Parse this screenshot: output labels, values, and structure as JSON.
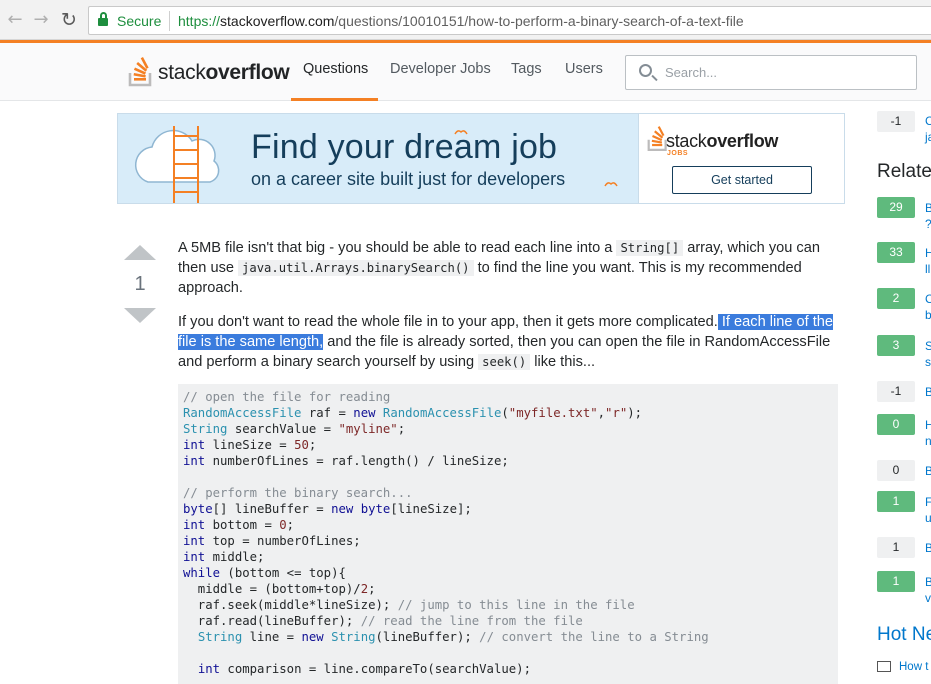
{
  "browser": {
    "secure_label": "Secure",
    "url_scheme": "https://",
    "url_host": "stackoverflow.com",
    "url_path": "/questions/10010151/how-to-perform-a-binary-search-of-a-text-file"
  },
  "header": {
    "logo_light": "stack",
    "logo_bold": "overflow",
    "nav": [
      "Questions",
      "Developer Jobs",
      "Tags",
      "Users"
    ],
    "active_nav": "Questions",
    "search_placeholder": "Search..."
  },
  "ad": {
    "title": "Find your dream job",
    "subtitle": "on a career site built just for developers",
    "logo_light": "stack",
    "logo_bold": "overflow",
    "logo_sub": "JOBS",
    "button": "Get started"
  },
  "answer": {
    "votes": "1",
    "p1": {
      "t1": "A 5MB file isn't that big - you should be able to read each line into a ",
      "c1": "String[]",
      "t2": " array, which you can then use ",
      "c2": "java.util.Arrays.binarySearch()",
      "t3": " to find the line you want. This is my recommended approach."
    },
    "p2": {
      "t1": "If you don't want to read the whole file in to your app, then it gets more complicated.",
      "hl": " If each line of the file is the same length,",
      "t2": " and the file is already sorted, then you can open the file in RandomAccessFile and perform a binary search yourself by using ",
      "c1": "seek()",
      "t3": " like this..."
    },
    "code": [
      [
        [
          "c",
          "// open the file for reading"
        ]
      ],
      [
        [
          "t",
          "RandomAccessFile"
        ],
        [
          "p",
          " raf = "
        ],
        [
          "k",
          "new"
        ],
        [
          "p",
          " "
        ],
        [
          "t",
          "RandomAccessFile"
        ],
        [
          "p",
          "("
        ],
        [
          "s",
          "\"myfile.txt\""
        ],
        [
          "p",
          ","
        ],
        [
          "s",
          "\"r\""
        ],
        [
          "p",
          ");"
        ]
      ],
      [
        [
          "t",
          "String"
        ],
        [
          "p",
          " searchValue = "
        ],
        [
          "s",
          "\"myline\""
        ],
        [
          "p",
          ";"
        ]
      ],
      [
        [
          "k",
          "int"
        ],
        [
          "p",
          " lineSize = "
        ],
        [
          "n",
          "50"
        ],
        [
          "p",
          ";"
        ]
      ],
      [
        [
          "k",
          "int"
        ],
        [
          "p",
          " numberOfLines = raf.length() / lineSize;"
        ]
      ],
      [],
      [
        [
          "c",
          "// perform the binary search..."
        ]
      ],
      [
        [
          "k",
          "byte"
        ],
        [
          "p",
          "[] lineBuffer = "
        ],
        [
          "k",
          "new"
        ],
        [
          "p",
          " "
        ],
        [
          "k",
          "byte"
        ],
        [
          "p",
          "[lineSize];"
        ]
      ],
      [
        [
          "k",
          "int"
        ],
        [
          "p",
          " bottom = "
        ],
        [
          "n",
          "0"
        ],
        [
          "p",
          ";"
        ]
      ],
      [
        [
          "k",
          "int"
        ],
        [
          "p",
          " top = numberOfLines;"
        ]
      ],
      [
        [
          "k",
          "int"
        ],
        [
          "p",
          " middle;"
        ]
      ],
      [
        [
          "k",
          "while"
        ],
        [
          "p",
          " (bottom <= top){"
        ]
      ],
      [
        [
          "p",
          "  middle = (bottom+top)/"
        ],
        [
          "n",
          "2"
        ],
        [
          "p",
          ";"
        ]
      ],
      [
        [
          "p",
          "  raf.seek(middle*lineSize); "
        ],
        [
          "c",
          "// jump to this line in the file"
        ]
      ],
      [
        [
          "p",
          "  raf.read(lineBuffer); "
        ],
        [
          "c",
          "// read the line from the file"
        ]
      ],
      [
        [
          "p",
          "  "
        ],
        [
          "t",
          "String"
        ],
        [
          "p",
          " line = "
        ],
        [
          "k",
          "new"
        ],
        [
          "p",
          " "
        ],
        [
          "t",
          "String"
        ],
        [
          "p",
          "(lineBuffer); "
        ],
        [
          "c",
          "// convert the line to a String"
        ]
      ],
      [],
      [
        [
          "p",
          "  "
        ],
        [
          "k",
          "int"
        ],
        [
          "p",
          " comparison = line.compareTo(searchValue);"
        ]
      ]
    ]
  },
  "sidebar": {
    "top_badge": {
      "value": "-1",
      "letter": "C",
      "letter2": "ja"
    },
    "related_title": "Related",
    "related": [
      {
        "score": "29",
        "accepted": true,
        "letter": "B",
        "letter2": "?"
      },
      {
        "score": "33",
        "accepted": true,
        "letter": "H",
        "letter2": "ll"
      },
      {
        "score": "2",
        "accepted": true,
        "letter": "C",
        "letter2": "b"
      },
      {
        "score": "3",
        "accepted": true,
        "letter": "S",
        "letter2": "s"
      },
      {
        "score": "-1",
        "accepted": false,
        "letter": "B",
        "letter2": ""
      },
      {
        "score": "0",
        "accepted": true,
        "letter": "H",
        "letter2": "n"
      },
      {
        "score": "0",
        "accepted": false,
        "letter": "B",
        "letter2": ""
      },
      {
        "score": "1",
        "accepted": true,
        "letter": "F",
        "letter2": "u"
      },
      {
        "score": "1",
        "accepted": false,
        "letter": "B",
        "letter2": ""
      },
      {
        "score": "1",
        "accepted": true,
        "letter": "B",
        "letter2": "v"
      }
    ],
    "hot_title": "Hot Ne",
    "hot_first": "How t"
  },
  "colors": {
    "accent": "#f48024",
    "link": "#0077cc",
    "accepted": "#5fba7d",
    "selection": "#3b7cdd"
  }
}
